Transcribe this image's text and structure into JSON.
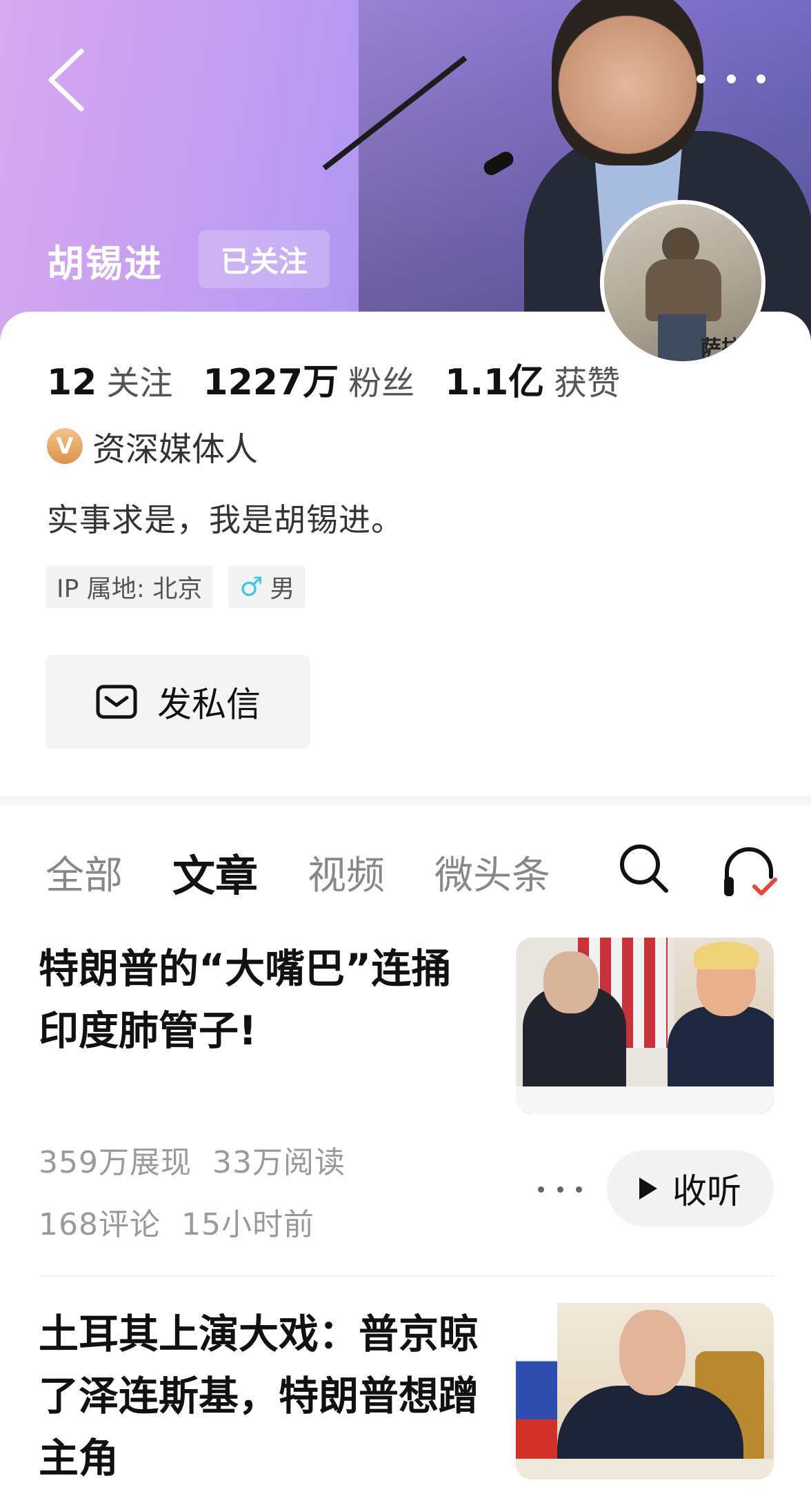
{
  "profile": {
    "name": "胡锡进",
    "follow_state": "已关注",
    "avatar_caption": "萨拉",
    "stats": [
      {
        "value": "12",
        "label": "关注"
      },
      {
        "value": "1227万",
        "label": "粉丝"
      },
      {
        "value": "1.1亿",
        "label": "获赞"
      }
    ],
    "verify_badge": "V",
    "verify_title": "资深媒体人",
    "bio": "实事求是，我是胡锡进。",
    "ip_tag": "IP 属地: 北京",
    "gender_symbol": "♂",
    "gender": "男",
    "dm_label": "发私信"
  },
  "tabs": [
    "全部",
    "文章",
    "视频",
    "微头条"
  ],
  "active_tab": "文章",
  "articles": [
    {
      "title": "特朗普的“大嘴巴”连捅印度肺管子!",
      "impressions": "359万展现",
      "reads": "33万阅读",
      "comments": "168评论",
      "time": "15小时前",
      "listen_label": "收听"
    },
    {
      "title": "土耳其上演大戏：普京晾了泽连斯基，特朗普想蹭主角"
    }
  ],
  "colors": {
    "banner_start": "#d9a8f0",
    "banner_end": "#7d78d8",
    "verify_badge": "#e3a35e",
    "gender_icon": "#3ec8e8",
    "listen_check": "#e8453c"
  },
  "icons": {
    "back": "chevron-left-icon",
    "more": "more-horizontal-icon",
    "message": "mail-icon",
    "search": "search-icon",
    "listen": "headphones-check-icon",
    "play": "play-icon"
  }
}
